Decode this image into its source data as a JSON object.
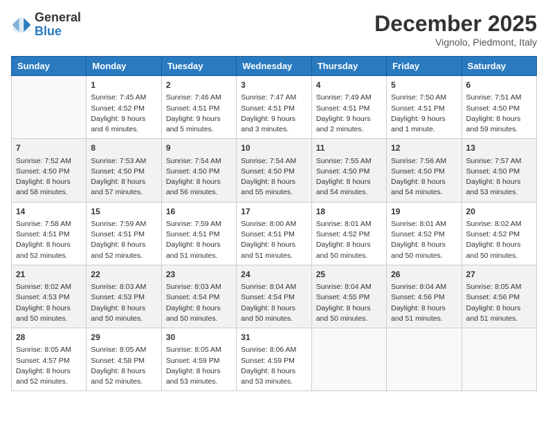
{
  "header": {
    "logo_general": "General",
    "logo_blue": "Blue",
    "month": "December 2025",
    "location": "Vignolo, Piedmont, Italy"
  },
  "weekdays": [
    "Sunday",
    "Monday",
    "Tuesday",
    "Wednesday",
    "Thursday",
    "Friday",
    "Saturday"
  ],
  "weeks": [
    [
      {
        "day": "",
        "sunrise": "",
        "sunset": "",
        "daylight": ""
      },
      {
        "day": "1",
        "sunrise": "Sunrise: 7:45 AM",
        "sunset": "Sunset: 4:52 PM",
        "daylight": "Daylight: 9 hours and 6 minutes."
      },
      {
        "day": "2",
        "sunrise": "Sunrise: 7:46 AM",
        "sunset": "Sunset: 4:51 PM",
        "daylight": "Daylight: 9 hours and 5 minutes."
      },
      {
        "day": "3",
        "sunrise": "Sunrise: 7:47 AM",
        "sunset": "Sunset: 4:51 PM",
        "daylight": "Daylight: 9 hours and 3 minutes."
      },
      {
        "day": "4",
        "sunrise": "Sunrise: 7:49 AM",
        "sunset": "Sunset: 4:51 PM",
        "daylight": "Daylight: 9 hours and 2 minutes."
      },
      {
        "day": "5",
        "sunrise": "Sunrise: 7:50 AM",
        "sunset": "Sunset: 4:51 PM",
        "daylight": "Daylight: 9 hours and 1 minute."
      },
      {
        "day": "6",
        "sunrise": "Sunrise: 7:51 AM",
        "sunset": "Sunset: 4:50 PM",
        "daylight": "Daylight: 8 hours and 59 minutes."
      }
    ],
    [
      {
        "day": "7",
        "sunrise": "Sunrise: 7:52 AM",
        "sunset": "Sunset: 4:50 PM",
        "daylight": "Daylight: 8 hours and 58 minutes."
      },
      {
        "day": "8",
        "sunrise": "Sunrise: 7:53 AM",
        "sunset": "Sunset: 4:50 PM",
        "daylight": "Daylight: 8 hours and 57 minutes."
      },
      {
        "day": "9",
        "sunrise": "Sunrise: 7:54 AM",
        "sunset": "Sunset: 4:50 PM",
        "daylight": "Daylight: 8 hours and 56 minutes."
      },
      {
        "day": "10",
        "sunrise": "Sunrise: 7:54 AM",
        "sunset": "Sunset: 4:50 PM",
        "daylight": "Daylight: 8 hours and 55 minutes."
      },
      {
        "day": "11",
        "sunrise": "Sunrise: 7:55 AM",
        "sunset": "Sunset: 4:50 PM",
        "daylight": "Daylight: 8 hours and 54 minutes."
      },
      {
        "day": "12",
        "sunrise": "Sunrise: 7:56 AM",
        "sunset": "Sunset: 4:50 PM",
        "daylight": "Daylight: 8 hours and 54 minutes."
      },
      {
        "day": "13",
        "sunrise": "Sunrise: 7:57 AM",
        "sunset": "Sunset: 4:50 PM",
        "daylight": "Daylight: 8 hours and 53 minutes."
      }
    ],
    [
      {
        "day": "14",
        "sunrise": "Sunrise: 7:58 AM",
        "sunset": "Sunset: 4:51 PM",
        "daylight": "Daylight: 8 hours and 52 minutes."
      },
      {
        "day": "15",
        "sunrise": "Sunrise: 7:59 AM",
        "sunset": "Sunset: 4:51 PM",
        "daylight": "Daylight: 8 hours and 52 minutes."
      },
      {
        "day": "16",
        "sunrise": "Sunrise: 7:59 AM",
        "sunset": "Sunset: 4:51 PM",
        "daylight": "Daylight: 8 hours and 51 minutes."
      },
      {
        "day": "17",
        "sunrise": "Sunrise: 8:00 AM",
        "sunset": "Sunset: 4:51 PM",
        "daylight": "Daylight: 8 hours and 51 minutes."
      },
      {
        "day": "18",
        "sunrise": "Sunrise: 8:01 AM",
        "sunset": "Sunset: 4:52 PM",
        "daylight": "Daylight: 8 hours and 50 minutes."
      },
      {
        "day": "19",
        "sunrise": "Sunrise: 8:01 AM",
        "sunset": "Sunset: 4:52 PM",
        "daylight": "Daylight: 8 hours and 50 minutes."
      },
      {
        "day": "20",
        "sunrise": "Sunrise: 8:02 AM",
        "sunset": "Sunset: 4:52 PM",
        "daylight": "Daylight: 8 hours and 50 minutes."
      }
    ],
    [
      {
        "day": "21",
        "sunrise": "Sunrise: 8:02 AM",
        "sunset": "Sunset: 4:53 PM",
        "daylight": "Daylight: 8 hours and 50 minutes."
      },
      {
        "day": "22",
        "sunrise": "Sunrise: 8:03 AM",
        "sunset": "Sunset: 4:53 PM",
        "daylight": "Daylight: 8 hours and 50 minutes."
      },
      {
        "day": "23",
        "sunrise": "Sunrise: 8:03 AM",
        "sunset": "Sunset: 4:54 PM",
        "daylight": "Daylight: 8 hours and 50 minutes."
      },
      {
        "day": "24",
        "sunrise": "Sunrise: 8:04 AM",
        "sunset": "Sunset: 4:54 PM",
        "daylight": "Daylight: 8 hours and 50 minutes."
      },
      {
        "day": "25",
        "sunrise": "Sunrise: 8:04 AM",
        "sunset": "Sunset: 4:55 PM",
        "daylight": "Daylight: 8 hours and 50 minutes."
      },
      {
        "day": "26",
        "sunrise": "Sunrise: 8:04 AM",
        "sunset": "Sunset: 4:56 PM",
        "daylight": "Daylight: 8 hours and 51 minutes."
      },
      {
        "day": "27",
        "sunrise": "Sunrise: 8:05 AM",
        "sunset": "Sunset: 4:56 PM",
        "daylight": "Daylight: 8 hours and 51 minutes."
      }
    ],
    [
      {
        "day": "28",
        "sunrise": "Sunrise: 8:05 AM",
        "sunset": "Sunset: 4:57 PM",
        "daylight": "Daylight: 8 hours and 52 minutes."
      },
      {
        "day": "29",
        "sunrise": "Sunrise: 8:05 AM",
        "sunset": "Sunset: 4:58 PM",
        "daylight": "Daylight: 8 hours and 52 minutes."
      },
      {
        "day": "30",
        "sunrise": "Sunrise: 8:05 AM",
        "sunset": "Sunset: 4:59 PM",
        "daylight": "Daylight: 8 hours and 53 minutes."
      },
      {
        "day": "31",
        "sunrise": "Sunrise: 8:06 AM",
        "sunset": "Sunset: 4:59 PM",
        "daylight": "Daylight: 8 hours and 53 minutes."
      },
      {
        "day": "",
        "sunrise": "",
        "sunset": "",
        "daylight": ""
      },
      {
        "day": "",
        "sunrise": "",
        "sunset": "",
        "daylight": ""
      },
      {
        "day": "",
        "sunrise": "",
        "sunset": "",
        "daylight": ""
      }
    ]
  ]
}
